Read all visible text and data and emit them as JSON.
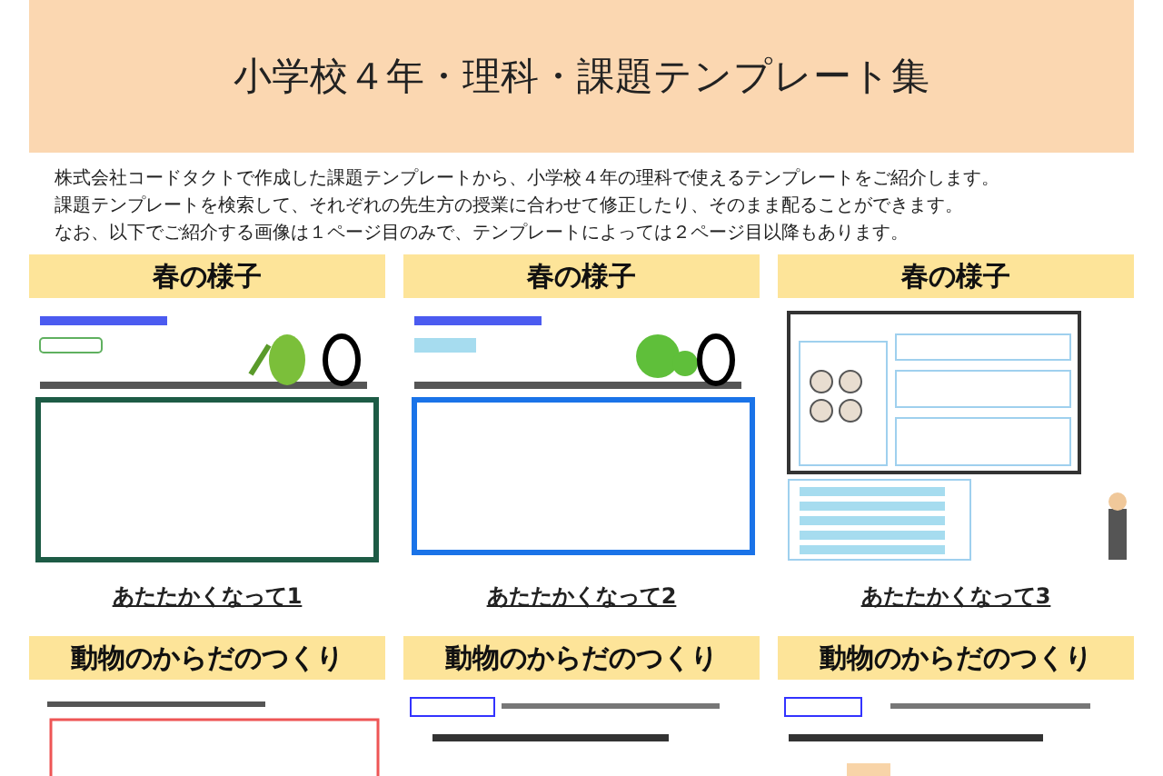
{
  "header": {
    "title": "小学校４年・理科・課題テンプレート集"
  },
  "intro": [
    "株式会社コードタクトで作成した課題テンプレートから、小学校４年の理科で使えるテンプレートをご紹介します。",
    "課題テンプレートを検索して、それぞれの先生方の授業に合わせて修正したり、そのまま配ることができます。",
    "なお、以下でご紹介する画像は１ページ目のみで、テンプレートによっては２ページ目以降もあります。"
  ],
  "cards": [
    {
      "heading": "春の様子",
      "thumbnail": {
        "kind": "mantis"
      },
      "link": "あたたかくなって1"
    },
    {
      "heading": "春の様子",
      "thumbnail": {
        "kind": "frog"
      },
      "link": "あたたかくなって2"
    },
    {
      "heading": "春の様子",
      "thumbnail": {
        "kind": "eggs"
      },
      "link": "あたたかくなって3"
    },
    {
      "heading": "動物のからだのつくり",
      "thumbnail": {
        "kind": "frame"
      }
    },
    {
      "heading": "動物のからだのつくり",
      "thumbnail": {
        "kind": "arm"
      }
    },
    {
      "heading": "動物のからだのつくり",
      "thumbnail": {
        "kind": "leg"
      }
    }
  ]
}
